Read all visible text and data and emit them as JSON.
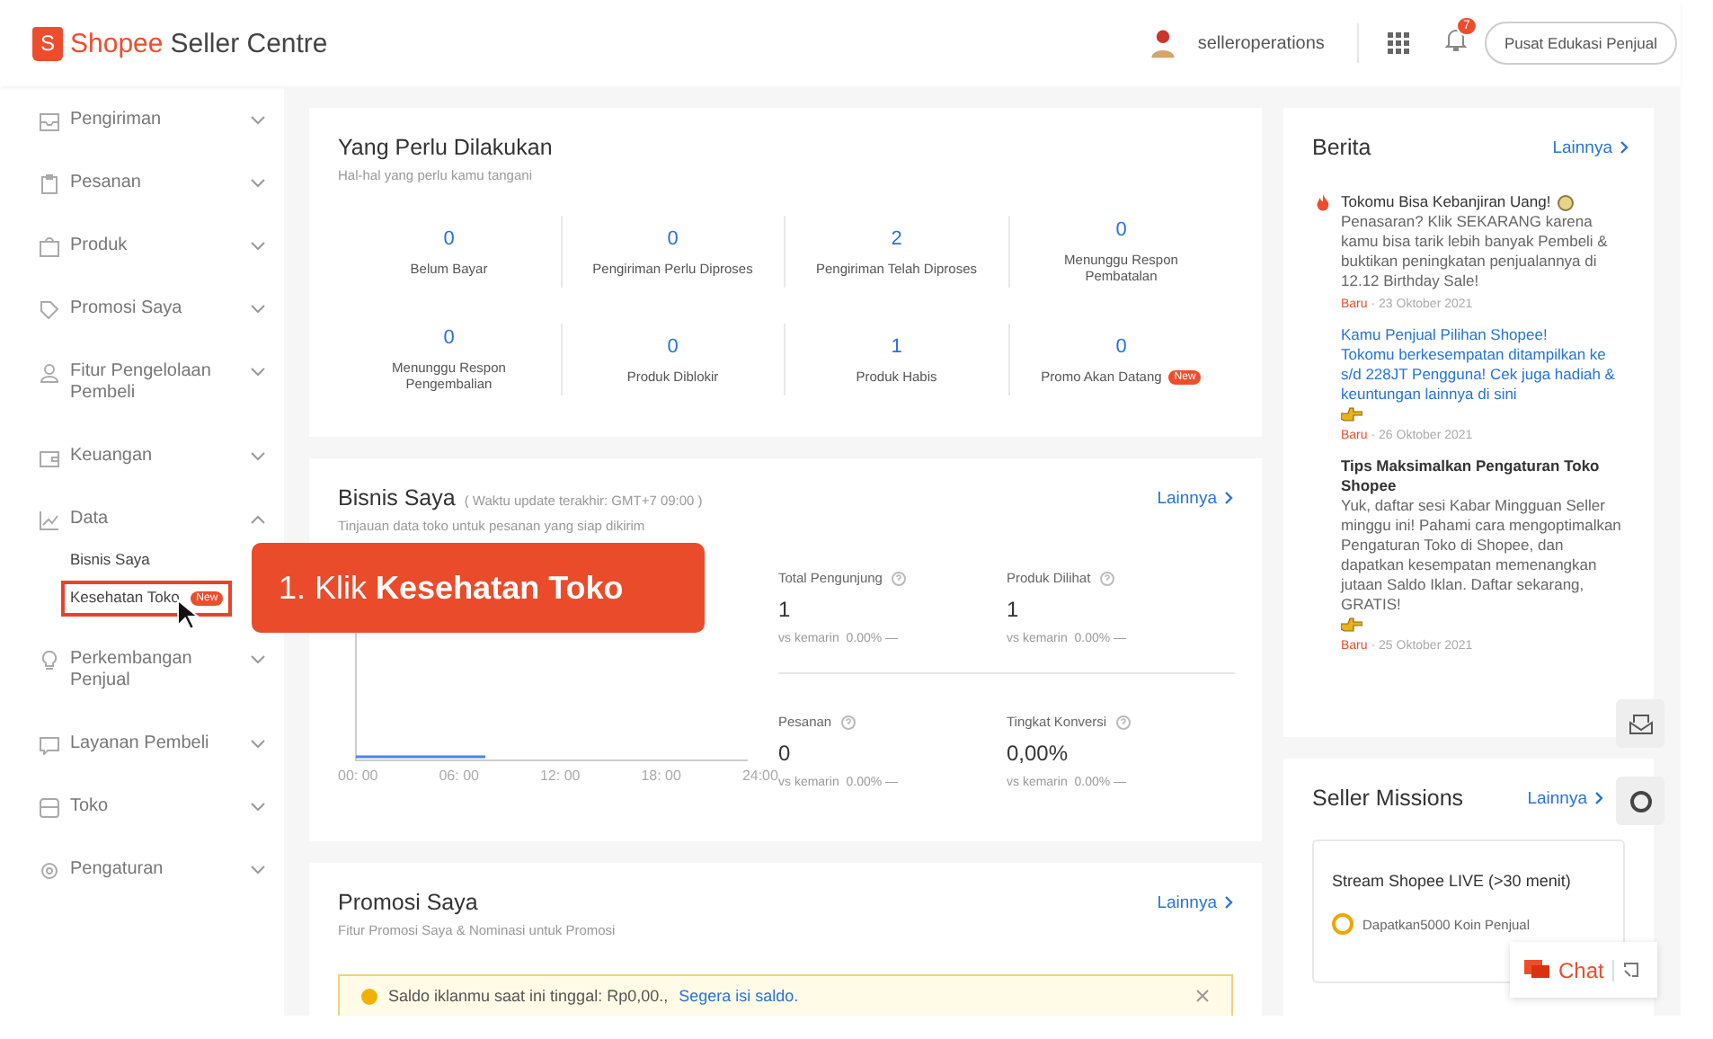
{
  "header": {
    "logo_letter": "S",
    "brand": "Shopee",
    "title": "Seller Centre",
    "user": "selleroperations",
    "notification_count": "7",
    "edu_button": "Pusat Edukasi Penjual"
  },
  "sidebar": {
    "items": [
      {
        "label": "Pengiriman",
        "expanded": false
      },
      {
        "label": "Pesanan",
        "expanded": false
      },
      {
        "label": "Produk",
        "expanded": false
      },
      {
        "label": "Promosi Saya",
        "expanded": false
      },
      {
        "label": "Fitur Pengelolaan Pembeli",
        "expanded": false
      },
      {
        "label": "Keuangan",
        "expanded": false
      },
      {
        "label": "Data",
        "expanded": true,
        "children": [
          {
            "label": "Bisnis Saya",
            "highlighted": false
          },
          {
            "label": "Kesehatan Toko",
            "badge": "New",
            "highlighted": true
          }
        ]
      },
      {
        "label": "Perkembangan Penjual",
        "expanded": false
      },
      {
        "label": "Layanan Pembeli",
        "expanded": false
      },
      {
        "label": "Toko",
        "expanded": false
      },
      {
        "label": "Pengaturan",
        "expanded": false
      }
    ]
  },
  "todo": {
    "title": "Yang Perlu Dilakukan",
    "subtitle": "Hal-hal yang perlu kamu tangani",
    "items": [
      {
        "value": "0",
        "label": "Belum Bayar"
      },
      {
        "value": "0",
        "label": "Pengiriman Perlu Diproses"
      },
      {
        "value": "2",
        "label": "Pengiriman Telah Diproses"
      },
      {
        "value": "0",
        "label": "Menunggu Respon Pembatalan"
      },
      {
        "value": "0",
        "label": "Menunggu Respon Pengembalian"
      },
      {
        "value": "0",
        "label": "Produk Diblokir"
      },
      {
        "value": "1",
        "label": "Produk Habis"
      },
      {
        "value": "0",
        "label": "Promo Akan Datang",
        "badge": "New"
      }
    ]
  },
  "business": {
    "title": "Bisnis Saya",
    "note": "( Waktu update terakhir: GMT+7 09:00 )",
    "subtitle": "Tinjauan data toko untuk pesanan yang siap dikirim",
    "more": "Lainnya",
    "chart_x_labels": [
      "00: 00",
      "06: 00",
      "12: 00",
      "18: 00",
      "24:00"
    ],
    "metrics": [
      {
        "label": "Total Pengunjung",
        "value": "1",
        "compare": "vs kemarin",
        "change": "0.00% —"
      },
      {
        "label": "Produk Dilihat",
        "value": "1",
        "compare": "vs kemarin",
        "change": "0.00% —"
      },
      {
        "label": "Pesanan",
        "value": "0",
        "compare": "vs kemarin",
        "change": "0.00% —"
      },
      {
        "label": "Tingkat Konversi",
        "value": "0,00%",
        "compare": "vs kemarin",
        "change": "0.00% —"
      }
    ]
  },
  "promotions": {
    "title": "Promosi Saya",
    "subtitle": "Fitur Promosi Saya & Nominasi untuk Promosi",
    "more": "Lainnya",
    "alert": "Saldo iklanmu saat ini tinggal: Rp0,00.,",
    "alert_link": "Segera isi saldo."
  },
  "news": {
    "title": "Berita",
    "more": "Lainnya",
    "items": [
      {
        "kind": "hot",
        "title": "Tokomu Bisa Kebanjiran Uang!",
        "body": "Penasaran? Klik SEKARANG karena kamu bisa tarik lebih banyak Pembeli & buktikan peningkatan penjualannya di 12.12 Birthday Sale!",
        "tag": "Baru",
        "date": "· 23 Oktober 2021"
      },
      {
        "kind": "link",
        "title": "Kamu Penjual Pilihan Shopee!",
        "body": "Tokomu berkesempatan ditampilkan ke s/d 228JT Pengguna! Cek juga hadiah & keuntungan lainnya di sini",
        "tag": "Baru",
        "date": "· 26 Oktober 2021"
      },
      {
        "kind": "plain",
        "title": "Tips Maksimalkan Pengaturan Toko Shopee",
        "body": "Yuk, daftar sesi Kabar Mingguan Seller minggu ini! Pahami cara mengoptimalkan Pengaturan Toko di Shopee, dan dapatkan kesempatan memenangkan jutaan Saldo Iklan. Daftar sekarang, GRATIS!",
        "tag": "Baru",
        "date": "· 25 Oktober 2021"
      }
    ]
  },
  "missions": {
    "title": "Seller Missions",
    "more": "Lainnya",
    "items": [
      {
        "title": "Stream Shopee LIVE (>30 menit)",
        "reward": "Dapatkan5000 Koin Penjual"
      }
    ]
  },
  "callout": {
    "text": "1. Klik **Kesehatan Toko**"
  },
  "chat": {
    "label": "Chat"
  }
}
